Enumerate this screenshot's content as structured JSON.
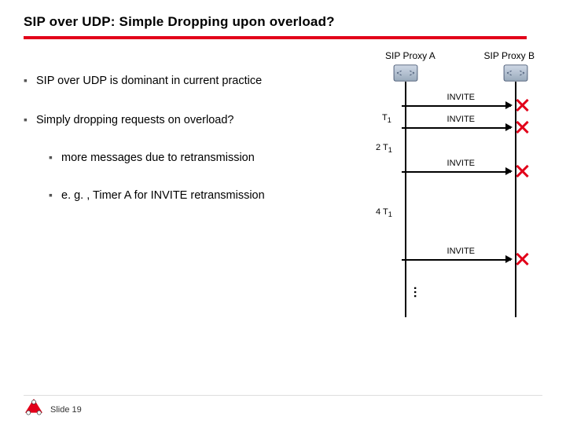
{
  "title": "SIP over UDP: Simple Dropping upon overload?",
  "bullets": {
    "b1": "SIP over UDP is dominant in current practice",
    "b2": "Simply dropping requests on overload?",
    "b2a": "more messages due to retransmission",
    "b2b": "e. g. , Timer A for INVITE retransmission"
  },
  "diagram": {
    "proxyA": "SIP Proxy A",
    "proxyB": "SIP Proxy B",
    "msg1": "INVITE",
    "msg2": "INVITE",
    "msg3": "INVITE",
    "msg4": "INVITE",
    "t1": "T",
    "t1sub": "1",
    "t2": "2 T",
    "t2sub": "1",
    "t3": "4 T",
    "t3sub": "1",
    "dots": "…"
  },
  "footer": {
    "slide": "Slide 19"
  },
  "colors": {
    "accent": "#e2001a"
  }
}
